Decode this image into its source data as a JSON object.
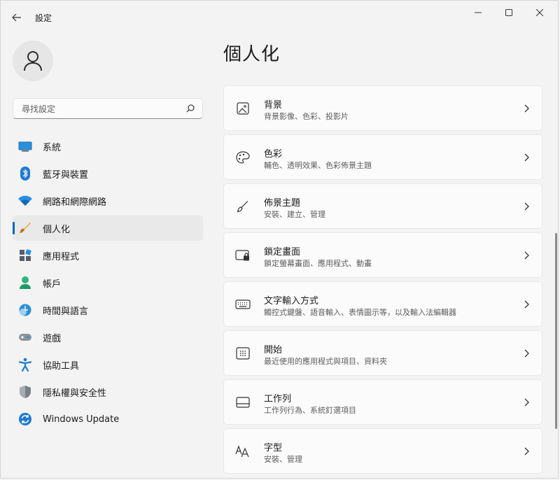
{
  "window": {
    "title": "設定"
  },
  "search": {
    "placeholder": "尋找設定"
  },
  "sidebar": {
    "items": [
      {
        "label": "系統",
        "icon": "system-icon"
      },
      {
        "label": "藍牙與裝置",
        "icon": "bluetooth-icon"
      },
      {
        "label": "網路和網際網路",
        "icon": "wifi-icon"
      },
      {
        "label": "個人化",
        "icon": "brush-icon",
        "selected": true
      },
      {
        "label": "應用程式",
        "icon": "apps-icon"
      },
      {
        "label": "帳戶",
        "icon": "account-icon"
      },
      {
        "label": "時間與語言",
        "icon": "time-language-icon"
      },
      {
        "label": "遊戲",
        "icon": "gamepad-icon"
      },
      {
        "label": "協助工具",
        "icon": "accessibility-icon"
      },
      {
        "label": "隱私權與安全性",
        "icon": "shield-icon"
      },
      {
        "label": "Windows Update",
        "icon": "windows-update-icon"
      }
    ]
  },
  "main": {
    "title": "個人化",
    "cards": [
      {
        "title": "背景",
        "desc": "背景影像、色彩、投影片",
        "icon": "image-icon"
      },
      {
        "title": "色彩",
        "desc": "輔色、透明效果、色彩佈景主題",
        "icon": "palette-icon"
      },
      {
        "title": "佈景主題",
        "desc": "安裝、建立、管理",
        "icon": "brush-icon"
      },
      {
        "title": "鎖定畫面",
        "desc": "鎖定螢幕畫面、應用程式、動畫",
        "icon": "lock-screen-icon"
      },
      {
        "title": "文字輸入方式",
        "desc": "觸控式鍵盤、語音輸入、表情圖示等，以及輸入法編輯器",
        "icon": "keyboard-icon"
      },
      {
        "title": "開始",
        "desc": "最近使用的應用程式與項目、資料夾",
        "icon": "start-icon"
      },
      {
        "title": "工作列",
        "desc": "工作列行為、系統釘選項目",
        "icon": "taskbar-icon"
      },
      {
        "title": "字型",
        "desc": "安裝、管理",
        "icon": "font-icon"
      }
    ]
  },
  "colors": {
    "accent": "#0067c0",
    "background": "#f3f3f3",
    "card": "#fbfbfb"
  }
}
